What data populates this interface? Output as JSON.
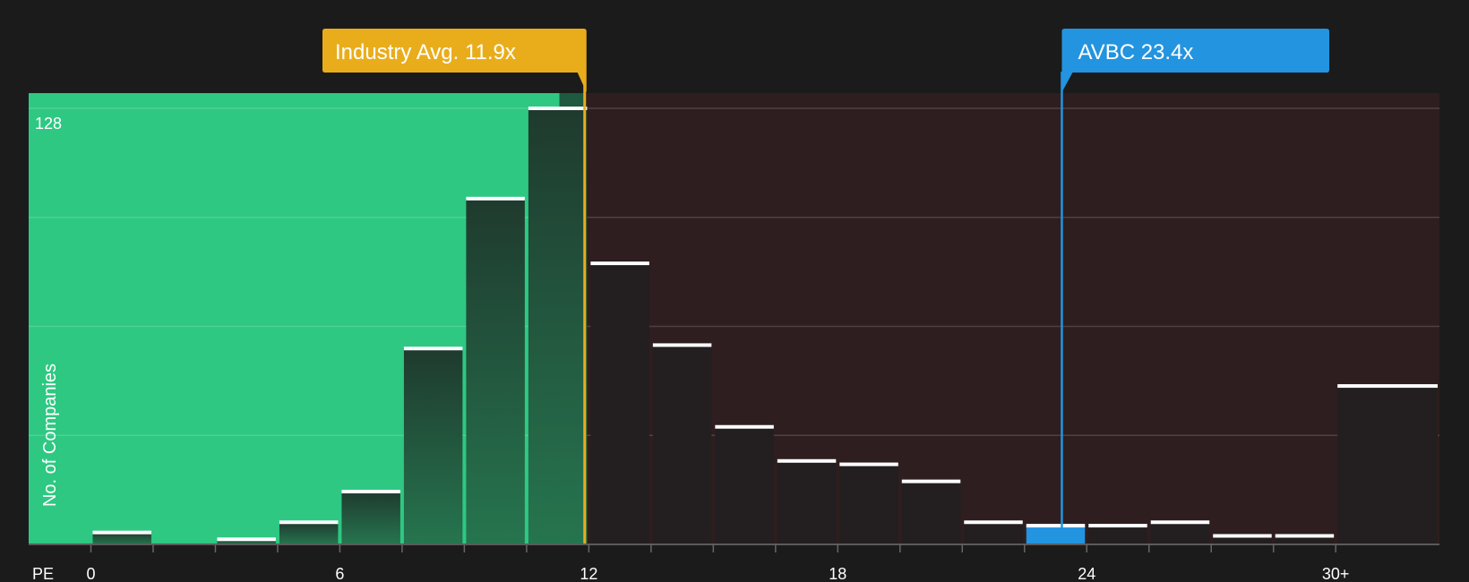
{
  "chart_data": {
    "type": "bar",
    "xlabel": "PE",
    "ylabel": "No. of Companies",
    "x_range": [
      -1.5,
      32.5
    ],
    "ylim": [
      0,
      128
    ],
    "ymax_label": "128",
    "x_ticks": [
      {
        "value": 0,
        "label": "0"
      },
      {
        "value": 6,
        "label": "6"
      },
      {
        "value": 12,
        "label": "12"
      },
      {
        "value": 18,
        "label": "18"
      },
      {
        "value": 24,
        "label": "24"
      },
      {
        "value": 30,
        "label": "30+"
      }
    ],
    "bins": [
      {
        "start": 0,
        "end": 1.5,
        "value": 3.5
      },
      {
        "start": 1.5,
        "end": 3,
        "value": 0
      },
      {
        "start": 3,
        "end": 4.5,
        "value": 1.5
      },
      {
        "start": 4.5,
        "end": 6,
        "value": 6.5
      },
      {
        "start": 6,
        "end": 7.5,
        "value": 15.5
      },
      {
        "start": 7.5,
        "end": 9,
        "value": 57.5
      },
      {
        "start": 9,
        "end": 10.5,
        "value": 101.5
      },
      {
        "start": 10.5,
        "end": 12,
        "value": 128
      },
      {
        "start": 12,
        "end": 13.5,
        "value": 82.5
      },
      {
        "start": 13.5,
        "end": 15,
        "value": 58.5
      },
      {
        "start": 15,
        "end": 16.5,
        "value": 34.5
      },
      {
        "start": 16.5,
        "end": 18,
        "value": 24.5
      },
      {
        "start": 18,
        "end": 19.5,
        "value": 23.5
      },
      {
        "start": 19.5,
        "end": 21,
        "value": 18.5
      },
      {
        "start": 21,
        "end": 22.5,
        "value": 6.5
      },
      {
        "start": 22.5,
        "end": 24,
        "value": 5.5
      },
      {
        "start": 24,
        "end": 25.5,
        "value": 5.5
      },
      {
        "start": 25.5,
        "end": 27,
        "value": 6.5
      },
      {
        "start": 27,
        "end": 28.5,
        "value": 2.5
      },
      {
        "start": 28.5,
        "end": 30,
        "value": 2.5
      },
      {
        "start": 30,
        "end": 32.5,
        "value": 46.5
      }
    ],
    "highlight_bin": 15,
    "industry_avg": {
      "value": 11.9,
      "label": "Industry Avg. 11.9x"
    },
    "company": {
      "name": "AVBC",
      "value": 23.4,
      "label": "AVBC 23.4x"
    },
    "grid": true,
    "colors": {
      "background": "#1b1b1b",
      "undervalued_zone": "#2ec882",
      "overvalued_zone": "#2e1e1f",
      "industry_avg": "#e9ad1c",
      "company": "#2394e0",
      "bar_top": "#ffffff"
    }
  }
}
